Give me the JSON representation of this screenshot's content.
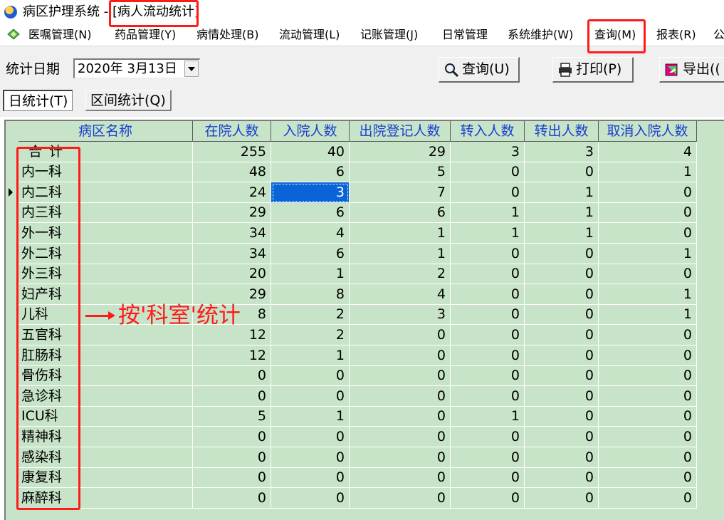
{
  "window": {
    "app_title": "病区护理系统 -",
    "sub_title": "[病人流动统计]"
  },
  "menu": {
    "items": [
      {
        "label": "医嘱管理(N)"
      },
      {
        "label": "药品管理(Y)"
      },
      {
        "label": "病情处理(B)"
      },
      {
        "label": "流动管理(L)"
      },
      {
        "label": "记账管理(J)"
      },
      {
        "label": "日常管理"
      },
      {
        "label": "系统维护(W)"
      },
      {
        "label": "查询(M)"
      },
      {
        "label": "报表(R)"
      },
      {
        "label": "公"
      }
    ]
  },
  "toolbar": {
    "date_label": "统计日期",
    "date_value": "2020年  3月13日",
    "query_label": "查询(U)",
    "print_label": "打印(P)",
    "export_label": "导出(("
  },
  "tabs": [
    {
      "label": "日统计(T)"
    },
    {
      "label": "区间统计(Q)"
    }
  ],
  "table": {
    "columns": [
      "病区名称",
      "在院人数",
      "入院人数",
      "出院登记人数",
      "转入人数",
      "转出人数",
      "取消入院人数"
    ],
    "rows": [
      {
        "name": "合计",
        "vals": [
          "255",
          "40",
          "29",
          "3",
          "3",
          "4"
        ]
      },
      {
        "name": "内一科",
        "vals": [
          "48",
          "6",
          "5",
          "0",
          "0",
          "1"
        ]
      },
      {
        "name": "内二科",
        "vals": [
          "24",
          "3",
          "7",
          "0",
          "1",
          "0"
        ]
      },
      {
        "name": "内三科",
        "vals": [
          "29",
          "6",
          "6",
          "1",
          "1",
          "0"
        ]
      },
      {
        "name": "外一科",
        "vals": [
          "34",
          "4",
          "1",
          "1",
          "1",
          "0"
        ]
      },
      {
        "name": "外二科",
        "vals": [
          "34",
          "6",
          "1",
          "0",
          "0",
          "1"
        ]
      },
      {
        "name": "外三科",
        "vals": [
          "20",
          "1",
          "2",
          "0",
          "0",
          "0"
        ]
      },
      {
        "name": "妇产科",
        "vals": [
          "29",
          "8",
          "4",
          "0",
          "0",
          "1"
        ]
      },
      {
        "name": "儿科",
        "vals": [
          "8",
          "2",
          "3",
          "0",
          "0",
          "1"
        ]
      },
      {
        "name": "五官科",
        "vals": [
          "12",
          "2",
          "0",
          "0",
          "0",
          "0"
        ]
      },
      {
        "name": "肛肠科",
        "vals": [
          "12",
          "1",
          "0",
          "0",
          "0",
          "0"
        ]
      },
      {
        "name": "骨伤科",
        "vals": [
          "0",
          "0",
          "0",
          "0",
          "0",
          "0"
        ]
      },
      {
        "name": "急诊科",
        "vals": [
          "0",
          "0",
          "0",
          "0",
          "0",
          "0"
        ]
      },
      {
        "name": "ICU科",
        "vals": [
          "5",
          "1",
          "0",
          "1",
          "0",
          "0"
        ]
      },
      {
        "name": "精神科",
        "vals": [
          "0",
          "0",
          "0",
          "0",
          "0",
          "0"
        ]
      },
      {
        "name": "感染科",
        "vals": [
          "0",
          "0",
          "0",
          "0",
          "0",
          "0"
        ]
      },
      {
        "name": "康复科",
        "vals": [
          "0",
          "0",
          "0",
          "0",
          "0",
          "0"
        ]
      },
      {
        "name": "麻醉科",
        "vals": [
          "0",
          "0",
          "0",
          "0",
          "0",
          "0"
        ]
      }
    ]
  },
  "annotation": {
    "text": "按'科室'统计"
  },
  "colors": {
    "grid_background": "#c8e4c8",
    "header_text": "#1a3fd0",
    "selection": "#0a64d8",
    "highlight": "#ff1a1a"
  }
}
